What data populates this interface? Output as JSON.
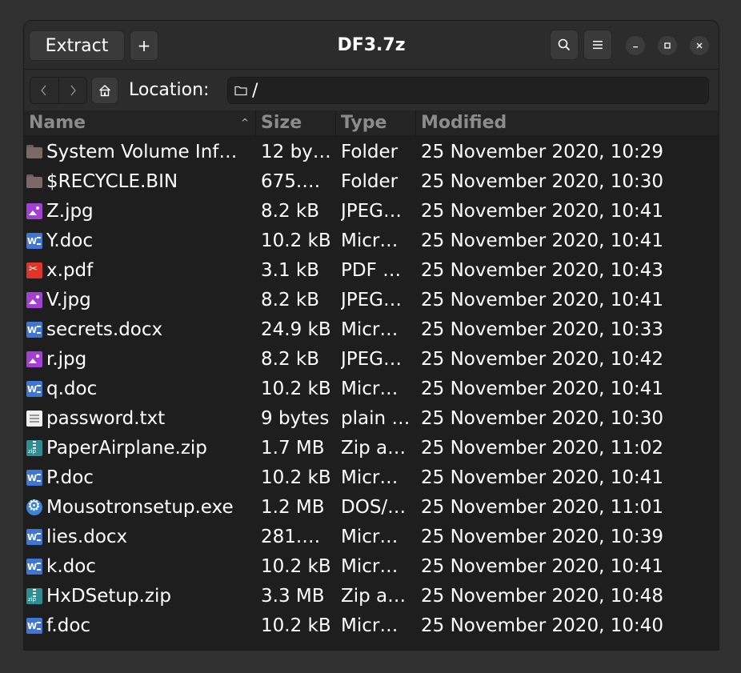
{
  "window": {
    "title": "DF3.7z"
  },
  "header": {
    "extract_label": "Extract",
    "add_label": "+",
    "search_icon": "search-icon",
    "menu_icon": "hamburger-menu-icon"
  },
  "window_controls": {
    "minimize": "–",
    "maximize": "□",
    "close": "×"
  },
  "location": {
    "label": "Location:",
    "path": "/"
  },
  "columns": {
    "name": "Name",
    "size": "Size",
    "type": "Type",
    "modified": "Modified"
  },
  "rows": [
    {
      "icon": "folder",
      "name": "System Volume Inf…",
      "size": "12 by…",
      "type": "Folder",
      "modified": "25 November 2020, 10:29"
    },
    {
      "icon": "folder",
      "name": "$RECYCLE.BIN",
      "size": "675.…",
      "type": "Folder",
      "modified": "25 November 2020, 10:30"
    },
    {
      "icon": "image",
      "name": "Z.jpg",
      "size": "8.2 kB",
      "type": "JPEG…",
      "modified": "25 November 2020, 10:41"
    },
    {
      "icon": "word",
      "name": "Y.doc",
      "size": "10.2 kB",
      "type": "Micr…",
      "modified": "25 November 2020, 10:41"
    },
    {
      "icon": "pdf",
      "name": "x.pdf",
      "size": "3.1 kB",
      "type": "PDF …",
      "modified": "25 November 2020, 10:43"
    },
    {
      "icon": "image",
      "name": "V.jpg",
      "size": "8.2 kB",
      "type": "JPEG…",
      "modified": "25 November 2020, 10:41"
    },
    {
      "icon": "word",
      "name": "secrets.docx",
      "size": "24.9 kB",
      "type": "Micr…",
      "modified": "25 November 2020, 10:33"
    },
    {
      "icon": "image",
      "name": "r.jpg",
      "size": "8.2 kB",
      "type": "JPEG…",
      "modified": "25 November 2020, 10:42"
    },
    {
      "icon": "word",
      "name": "q.doc",
      "size": "10.2 kB",
      "type": "Micr…",
      "modified": "25 November 2020, 10:41"
    },
    {
      "icon": "text",
      "name": "password.txt",
      "size": "9 bytes",
      "type": "plain …",
      "modified": "25 November 2020, 10:30"
    },
    {
      "icon": "zip",
      "name": "PaperAirplane.zip",
      "size": "1.7 MB",
      "type": "Zip a…",
      "modified": "25 November 2020, 11:02"
    },
    {
      "icon": "word",
      "name": "P.doc",
      "size": "10.2 kB",
      "type": "Micr…",
      "modified": "25 November 2020, 10:41"
    },
    {
      "icon": "exe",
      "name": "Mousotronsetup.exe",
      "size": "1.2 MB",
      "type": "DOS/…",
      "modified": "25 November 2020, 11:01"
    },
    {
      "icon": "word",
      "name": "lies.docx",
      "size": "281.…",
      "type": "Micr…",
      "modified": "25 November 2020, 10:39"
    },
    {
      "icon": "word",
      "name": "k.doc",
      "size": "10.2 kB",
      "type": "Micr…",
      "modified": "25 November 2020, 10:41"
    },
    {
      "icon": "zip",
      "name": "HxDSetup.zip",
      "size": "3.3 MB",
      "type": "Zip a…",
      "modified": "25 November 2020, 10:48"
    },
    {
      "icon": "word",
      "name": "f.doc",
      "size": "10.2 kB",
      "type": "Micr…",
      "modified": "25 November 2020, 10:40"
    }
  ]
}
